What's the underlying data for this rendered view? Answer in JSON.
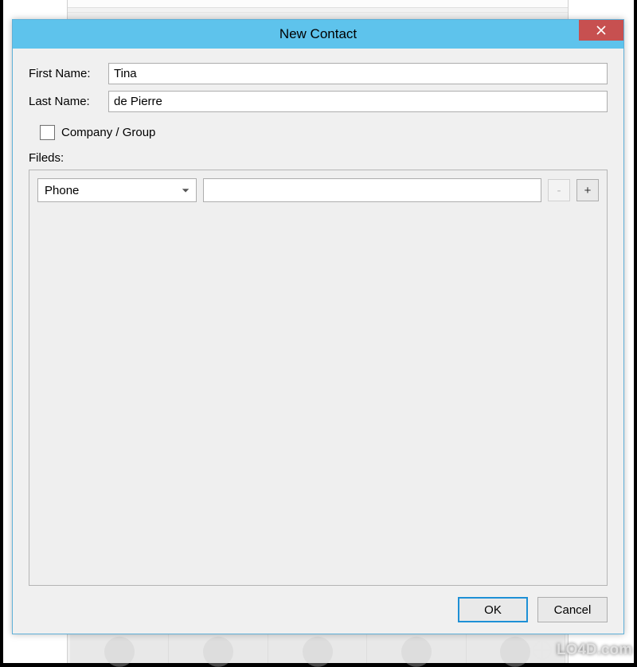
{
  "dialog": {
    "title": "New Contact",
    "firstNameLabel": "First Name:",
    "firstNameValue": "Tina",
    "lastNameLabel": "Last Name:",
    "lastNameValue": "de Pierre",
    "companyGroupLabel": "Company / Group",
    "companyGroupChecked": false,
    "fieldsLabel": "Fileds:",
    "field": {
      "typeSelected": "Phone",
      "value": "",
      "removeGlyph": "-",
      "addGlyph": "+"
    },
    "ok": "OK",
    "cancel": "Cancel"
  },
  "watermark": "LO4D.com"
}
